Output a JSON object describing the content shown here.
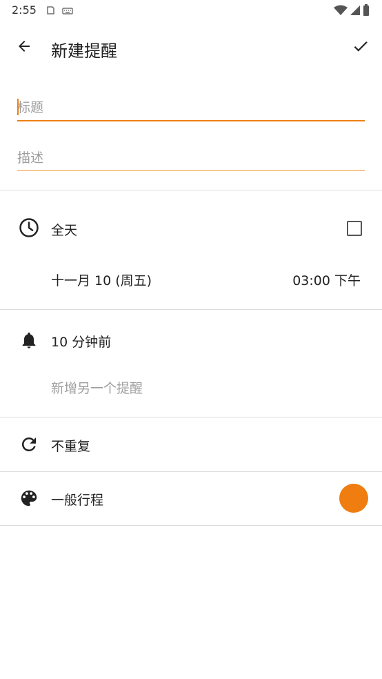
{
  "status_bar": {
    "time": "2:55",
    "left_icons": [
      "screenshot-icon",
      "keyboard-icon"
    ],
    "right_icons": [
      "wifi-icon",
      "signal-icon",
      "battery-icon"
    ]
  },
  "app_bar": {
    "title": "新建提醒",
    "back_icon": "arrow-left-icon",
    "save_icon": "check-icon"
  },
  "form": {
    "title_placeholder": "标题",
    "title_value": "",
    "description_placeholder": "描述",
    "description_value": ""
  },
  "time_section": {
    "all_day_label": "全天",
    "all_day_checked": false,
    "date": "十一月 10 (周五)",
    "time": "03:00 下午"
  },
  "reminder_section": {
    "reminder": "10 分钟前",
    "add_reminder": "新增另一个提醒"
  },
  "repeat_section": {
    "repeat": "不重复"
  },
  "category_section": {
    "category": "一般行程",
    "color": "#f07d0f"
  },
  "colors": {
    "accent": "#ef7f12",
    "divider": "#dddddd",
    "muted_text": "#9e9e9e"
  }
}
